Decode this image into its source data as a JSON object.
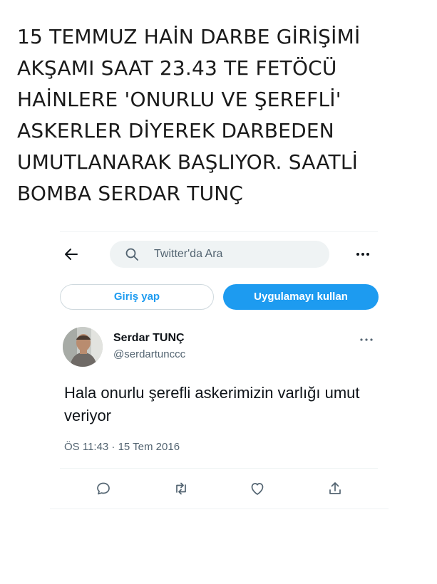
{
  "headline": {
    "lines": [
      "15 TEMMUZ HAİN DARBE GİRİŞİMİ",
      "AKŞAMI SAAT 23.43 TE FETÖCÜ",
      "HAİNLERE 'ONURLU VE ŞEREFLİ'",
      "ASKERLER DİYEREK DARBEDEN",
      "UMUTLANARAK BAŞLIYOR. SAATLİ",
      "BOMBA SERDAR TUNÇ"
    ]
  },
  "topbar": {
    "back_icon": "arrow-left-icon",
    "search_placeholder": "Twitter'da Ara",
    "search_icon": "search-icon",
    "more_icon": "more-horizontal-icon"
  },
  "auth": {
    "login_label": "Giriş yap",
    "app_label": "Uygulamayı kullan"
  },
  "tweet": {
    "author_name": "Serdar TUNÇ",
    "author_handle": "@serdartunccc",
    "text": "Hala onurlu şerefli askerimizin varlığı umut veriyor",
    "timestamp": "ÖS 11:43 · 15 Tem 2016",
    "actions": [
      "reply-icon",
      "retweet-icon",
      "like-icon",
      "share-icon"
    ]
  },
  "colors": {
    "accent": "#1d9bf0",
    "text": "#0f1419",
    "secondary": "#536471",
    "divider": "#eff3f4"
  }
}
